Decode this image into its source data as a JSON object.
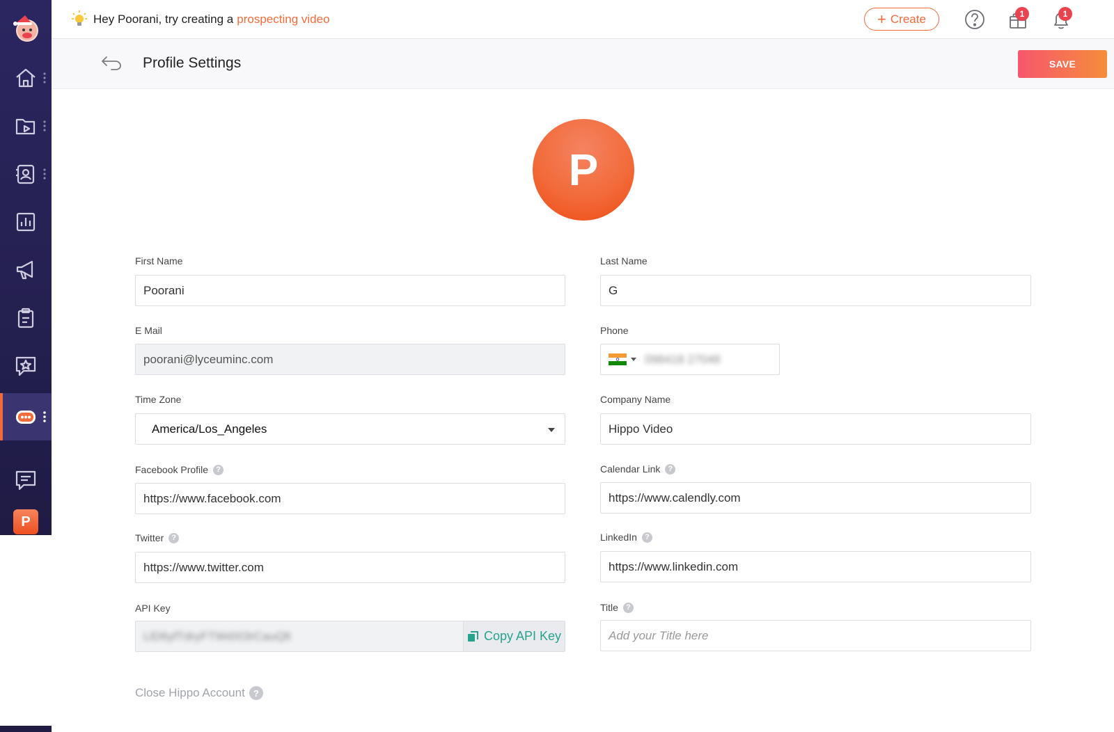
{
  "topbar": {
    "hint_prefix": "Hey Poorani, try creating a",
    "hint_link": "prospecting video",
    "create_label": "Create",
    "gifts_badge": "1",
    "notifications_badge": "1"
  },
  "header": {
    "title": "Profile Settings",
    "save_label": "SAVE"
  },
  "profile": {
    "avatar_letter": "P"
  },
  "sidebar": {
    "avatar_letter": "P"
  },
  "form": {
    "first_name": {
      "label": "First Name",
      "value": "Poorani"
    },
    "last_name": {
      "label": "Last Name",
      "value": "G"
    },
    "email": {
      "label": "E Mail",
      "value": "poorani@lyceuminc.com"
    },
    "phone": {
      "label": "Phone",
      "value": "098418 27048"
    },
    "time_zone": {
      "label": "Time Zone",
      "value": "America/Los_Angeles"
    },
    "company_name": {
      "label": "Company Name",
      "value": "Hippo Video"
    },
    "facebook": {
      "label": "Facebook Profile",
      "value": "https://www.facebook.com"
    },
    "calendar": {
      "label": "Calendar Link",
      "value": "https://www.calendly.com"
    },
    "twitter": {
      "label": "Twitter",
      "value": "https://www.twitter.com"
    },
    "linkedin": {
      "label": "LinkedIn",
      "value": "https://www.linkedin.com"
    },
    "api_key": {
      "label": "API Key",
      "value": "LlD6yfTdryFTWdXl3rCauQlt",
      "copy_label": "Copy API Key"
    },
    "title": {
      "label": "Title",
      "placeholder": "Add your Title here"
    },
    "help_glyph": "?"
  },
  "footer": {
    "close_account": "Close Hippo Account"
  },
  "colors": {
    "accent": "#f26b3a",
    "sidebar_bg": "#2b2660",
    "copy_green": "#26a38d"
  }
}
